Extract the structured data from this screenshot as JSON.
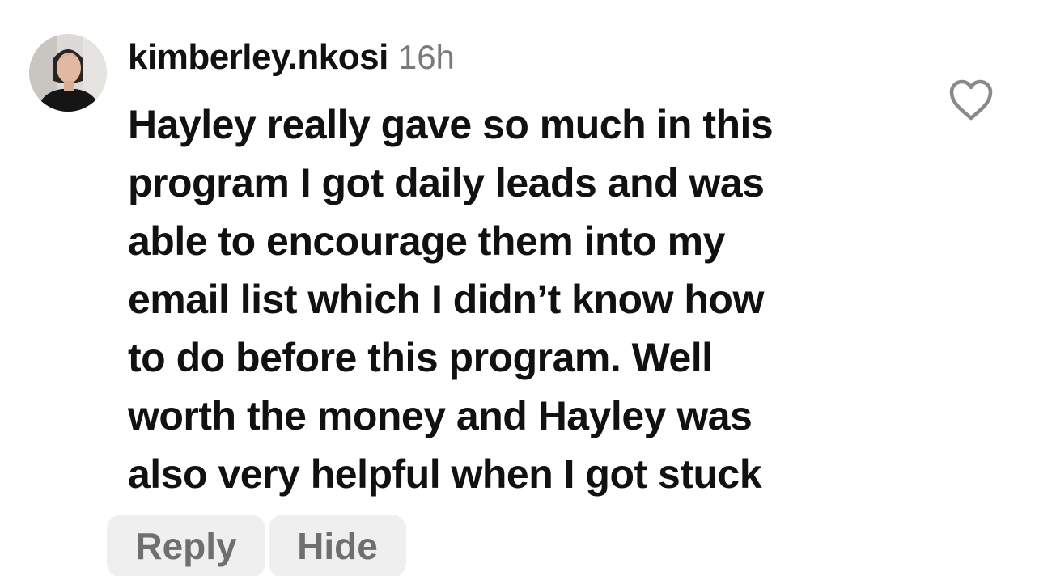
{
  "comment": {
    "username": "kimberley.nkosi",
    "timestamp": "16h",
    "lines": [
      "Hayley really gave so much in this",
      "program I got daily leads and was",
      "able to encourage them into my",
      "email list which I didn’t know how",
      "to do before this program. Well",
      "worth the money and Hayley was",
      "also very helpful when I got stuck"
    ],
    "avatar_icon": "profile-photo",
    "like_icon": "heart-outline-icon"
  },
  "actions": {
    "reply_label": "Reply",
    "hide_label": "Hide"
  },
  "colors": {
    "text": "#111111",
    "timestamp": "#7a7a7a",
    "button_bg": "#efefef",
    "button_text": "#6f6f6f",
    "heart_stroke": "#8a8a8a"
  }
}
